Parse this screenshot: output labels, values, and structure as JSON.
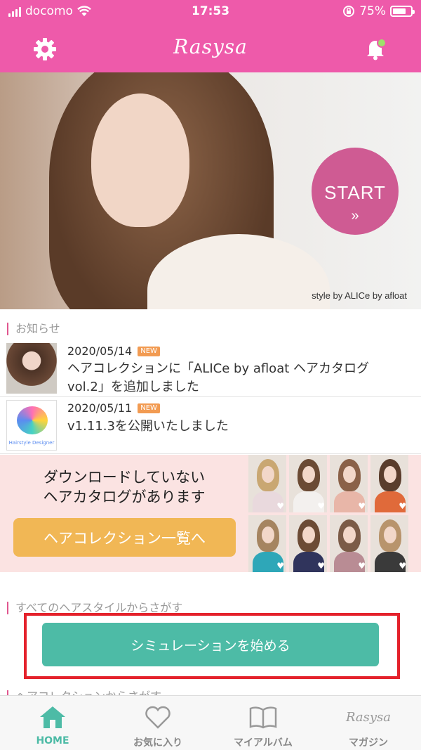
{
  "status_bar": {
    "carrier": "docomo",
    "time": "17:53",
    "battery": "75%",
    "battery_level": 0.75
  },
  "header": {
    "logo": "Rasysa"
  },
  "hero": {
    "start_label": "START",
    "start_chevron": "»",
    "credit": "style by ALICe by afloat"
  },
  "news": {
    "title": "お知らせ",
    "items": [
      {
        "date": "2020/05/14",
        "badge": "NEW",
        "text": "ヘアコレクションに「ALICe by afloat ヘアカタログ vol.2」を追加しました"
      },
      {
        "date": "2020/05/11",
        "badge": "NEW",
        "text": "v1.11.3を公開いたしました",
        "thumb_caption": "Hairstyle Designer"
      }
    ]
  },
  "catalog": {
    "message_line1": "ダウンロードしていない",
    "message_line2": "ヘアカタログがあります",
    "button": "ヘアコレクション一覧へ"
  },
  "search": {
    "title": "すべてのヘアスタイルからさがす",
    "button": "シミュレーションを始める"
  },
  "collection_partial_title": "ヘアコレクションからさがす",
  "tabs": [
    {
      "label": "HOME",
      "icon": "home-icon",
      "active": true
    },
    {
      "label": "お気に入り",
      "icon": "heart-icon",
      "active": false
    },
    {
      "label": "マイアルバム",
      "icon": "book-icon",
      "active": false
    },
    {
      "label": "マガジン",
      "icon": "rasysa-logo-icon",
      "active": false
    }
  ],
  "colors": {
    "brand_pink": "#ee5aaa",
    "accent_teal": "#4dbba6",
    "catalog_button": "#f1b755",
    "highlight_red": "#e4222c"
  }
}
